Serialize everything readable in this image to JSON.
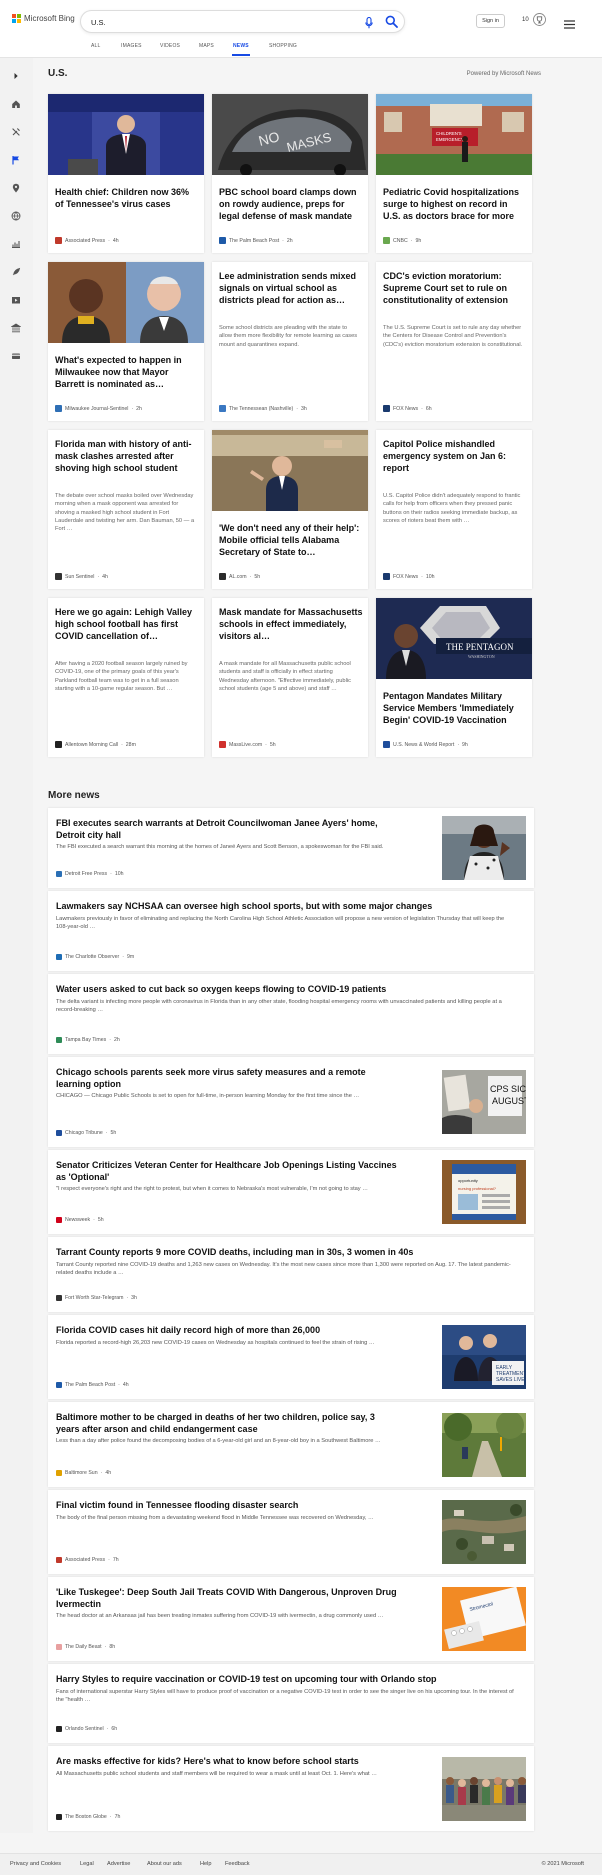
{
  "header": {
    "logo_text": "Microsoft Bing",
    "search_value": "U.S.",
    "sign_in": "Sign in",
    "rewards_count": "10"
  },
  "nav_tabs": [
    "ALL",
    "IMAGES",
    "VIDEOS",
    "MAPS",
    "NEWS",
    "SHOPPING"
  ],
  "active_tab": "NEWS",
  "sidebar_icons": [
    "chevron-right-icon",
    "home-icon",
    "tools-icon",
    "flag-icon",
    "location-icon",
    "globe-icon",
    "scale-icon",
    "rocket-icon",
    "movie-icon",
    "bank-icon",
    "card-icon"
  ],
  "section": {
    "title": "U.S.",
    "powered_by": "Powered by Microsoft News"
  },
  "top_stories": [
    {
      "title": "Health chief: Children now 36% of Tennessee's virus cases",
      "snippet": "",
      "source": "Associated Press",
      "age": "4h",
      "source_color": "#c0392b",
      "image": "press-conference-photo"
    },
    {
      "title": "PBC school board clamps down on rowdy audience, preps for legal defense of mask mandate",
      "snippet": "",
      "source": "The Palm Beach Post",
      "age": "2h",
      "source_color": "#1e5aa8",
      "image": "no-masks-vehicle-photo"
    },
    {
      "title": "Pediatric Covid hospitalizations surge to highest on record in U.S. as doctors brace for more",
      "snippet": "",
      "source": "CNBC",
      "age": "9h",
      "source_color": "#6aa84f",
      "image": "children-emergency-photo"
    },
    {
      "title": "What's expected to happen in Milwaukee now that Mayor Barrett is nominated as…",
      "snippet": "",
      "source": "Milwaukee Journal-Sentinel",
      "age": "2h",
      "source_color": "#2f6fb5",
      "image": "two-men-portrait-photo"
    },
    {
      "title": "Lee administration sends mixed signals on virtual school as districts plead for action as…",
      "snippet": "Some school districts are pleading with the state to allow them more flexibility for remote learning as cases mount and quarantines expand.",
      "source": "The Tennessean (Nashville)",
      "age": "3h",
      "source_color": "#3a78c2",
      "image": ""
    },
    {
      "title": "CDC's eviction moratorium: Supreme Court set to rule on constitutionality of extension",
      "snippet": "The U.S. Supreme Court is set to rule any day whether the Centers for Disease Control and Prevention's (CDC's) eviction moratorium extension is constitutional.",
      "source": "FOX News",
      "age": "6h",
      "source_color": "#1a3a6e",
      "image": ""
    },
    {
      "title": "Florida man with history of anti-mask clashes arrested after shoving high school student",
      "snippet": "The debate over school masks boiled over Wednesday morning when a mask opponent was arrested for shoving a masked high school student in Fort Lauderdale and twisting her arm. Dan Bauman, 50 — a Fort …",
      "source": "Sun Sentinel",
      "age": "4h",
      "source_color": "#333333",
      "image": ""
    },
    {
      "title": "'We don't need any of their help': Mobile official tells Alabama Secretary of State to…",
      "snippet": "",
      "source": "AL.com",
      "age": "5h",
      "source_color": "#2b2b2b",
      "image": "speaker-stage-photo"
    },
    {
      "title": "Capitol Police mishandled emergency system on Jan 6: report",
      "snippet": "U.S. Capitol Police didn't adequately respond to frantic calls for help from officers when they pressed panic buttons on their radios seeking immediate backup, as scores of rioters beat them with …",
      "source": "FOX News",
      "age": "10h",
      "source_color": "#1a3a6e",
      "image": ""
    },
    {
      "title": "Here we go again: Lehigh Valley high school football has first COVID cancellation of…",
      "snippet": "After having a 2020 football season largely ruined by COVID-19, one of the primary goals of this year's Parkland football team was to get in a full season starting with a 10-game regular season. But …",
      "source": "Allentown Morning Call",
      "age": "28m",
      "source_color": "#222222",
      "image": ""
    },
    {
      "title": "Mask mandate for Massachusetts schools in effect immediately, visitors al…",
      "snippet": "A mask mandate for all Massachusetts public school students and staff is officially in effect starting Wednesday afternoon. \"Effective immediately, public school students (age 5 and above) and staff …",
      "source": "MassLive.com",
      "age": "5h",
      "source_color": "#d0312d",
      "image": ""
    },
    {
      "title": "Pentagon Mandates Military Service Members 'Immediately Begin' COVID-19 Vaccination",
      "snippet": "",
      "source": "U.S. News & World Report",
      "age": "9h",
      "source_color": "#1f4e9c",
      "image": "pentagon-podium-photo"
    }
  ],
  "more_news": {
    "title": "More news",
    "items": [
      {
        "title": "FBI executes search warrants at Detroit Councilwoman Janee Ayers' home, Detroit city hall",
        "snippet": "The FBI executed a search warrant this morning at the homes of Janeé Ayers and Scott Benson, a spokeswoman for the FBI said.",
        "source": "Detroit Free Press",
        "age": "10h",
        "source_color": "#2a6fb5",
        "image": "councilwoman-photo"
      },
      {
        "title": "Lawmakers say NCHSAA can oversee high school sports, but with some major changes",
        "snippet": "Lawmakers previously in favor of eliminating and replacing the North Carolina High School Athletic Association will propose a new version of legislation Thursday that will keep the 108-year-old …",
        "source": "The Charlotte Observer",
        "age": "9m",
        "source_color": "#1e6db5",
        "image": ""
      },
      {
        "title": "Water users asked to cut back so oxygen keeps flowing to COVID-19 patients",
        "snippet": "The delta variant is infecting more people with coronavirus in Florida than in any other state, flooding hospital emergency rooms with unvaccinated patients and killing people at a record-breaking …",
        "source": "Tampa Bay Times",
        "age": "2h",
        "source_color": "#2e8b57",
        "image": ""
      },
      {
        "title": "Chicago schools parents seek more virus safety measures and a remote learning option",
        "snippet": "CHICAGO — Chicago Public Schools is set to open for full-time, in-person learning Monday for the first time since the …",
        "source": "Chicago Tribune",
        "age": "5h",
        "source_color": "#1f4e9c",
        "image": "protest-signs-photo"
      },
      {
        "title": "Senator Criticizes Veteran Center for Healthcare Job Openings Listing Vaccines as 'Optional'",
        "snippet": "\"I respect everyone's right and the right to protest, but when it comes to Nebraska's most vulnerable, I'm not going to stay …",
        "source": "Newsweek",
        "age": "5h",
        "source_color": "#d0021b",
        "image": "job-poster-photo"
      },
      {
        "title": "Tarrant County reports 9 more COVID deaths, including man in 30s, 3 women in 40s",
        "snippet": "Tarrant County reported nine COVID-19 deaths and 1,263 new cases on Wednesday. It's the most new cases since more than 1,300 were reported on Aug. 17. The latest pandemic-related deaths include a …",
        "source": "Fort Worth Star-Telegram",
        "age": "3h",
        "source_color": "#333333",
        "image": ""
      },
      {
        "title": "Florida COVID cases hit daily record high of more than 26,000",
        "snippet": "Florida reported a record-high 26,203 new COVID-19 cases on Wednesday as hospitals continued to feel the strain of rising …",
        "source": "The Palm Beach Post",
        "age": "4h",
        "source_color": "#1e5aa8",
        "image": "governor-podium-photo"
      },
      {
        "title": "Baltimore mother to be charged in deaths of her two children, police say, 3 years after arson and child endangerment case",
        "snippet": "Less than a day after police found the decomposing bodies of a 6-year-old girl and an 8-year-old boy in a Southwest Baltimore …",
        "source": "Baltimore Sun",
        "age": "4h",
        "source_color": "#e0a100",
        "image": "park-path-photo"
      },
      {
        "title": "Final victim found in Tennessee flooding disaster search",
        "snippet": "The body of the final person missing from a devastating weekend flood in Middle Tennessee was recovered on Wednesday, …",
        "source": "Associated Press",
        "age": "7h",
        "source_color": "#c0392b",
        "image": "aerial-flood-photo"
      },
      {
        "title": "'Like Tuskegee': Deep South Jail Treats COVID With Dangerous, Unproven Drug Ivermectin",
        "snippet": "The head doctor at an Arkansas jail has been treating inmates suffering from COVID-19 with ivermectin, a drug commonly used …",
        "source": "The Daily Beast",
        "age": "8h",
        "source_color": "#e8a0a0",
        "image": "pill-box-photo"
      },
      {
        "title": "Harry Styles to require vaccination or COVID-19 test on upcoming tour with Orlando stop",
        "snippet": "Fans of international superstar Harry Styles will have to produce proof of vaccination or a negative COVID-19 test in order to see the singer live on his upcoming tour. In the interest of the \"health …",
        "source": "Orlando Sentinel",
        "age": "6h",
        "source_color": "#222222",
        "image": ""
      },
      {
        "title": "Are masks effective for kids? Here's what to know before school starts",
        "snippet": "All Massachusetts public school students and staff members will be required to wear a mask until at least Oct. 1. Here's what …",
        "source": "The Boston Globe",
        "age": "7h",
        "source_color": "#222222",
        "image": "students-line-photo"
      }
    ]
  },
  "footer": {
    "links": [
      "Privacy and Cookies",
      "Legal",
      "Advertise",
      "About our ads",
      "Help",
      "Feedback"
    ],
    "copyright": "© 2021 Microsoft"
  }
}
